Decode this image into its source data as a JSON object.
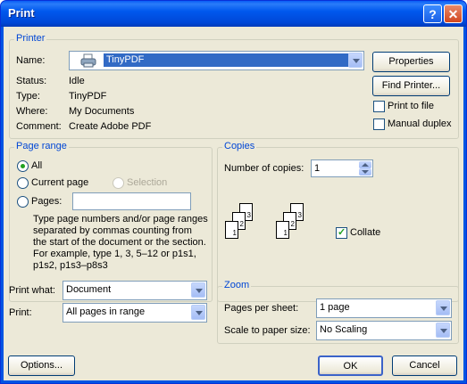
{
  "window": {
    "title": "Print"
  },
  "printer": {
    "group_label": "Printer",
    "name_label": "Name:",
    "name_value": "TinyPDF",
    "status_label": "Status:",
    "status_value": "Idle",
    "type_label": "Type:",
    "type_value": "TinyPDF",
    "where_label": "Where:",
    "where_value": "My Documents",
    "comment_label": "Comment:",
    "comment_value": "Create Adobe PDF",
    "properties_button": "Properties",
    "find_printer_button": "Find Printer...",
    "print_to_file": "Print to file",
    "manual_duplex": "Manual duplex"
  },
  "page_range": {
    "group_label": "Page range",
    "all": "All",
    "current_page": "Current page",
    "selection": "Selection",
    "pages": "Pages:",
    "pages_value": "",
    "help": "Type page numbers and/or page ranges separated by commas counting from the start of the document or the section. For example, type 1, 3, 5–12 or p1s1, p1s2, p1s3–p8s3"
  },
  "copies": {
    "group_label": "Copies",
    "number_label": "Number of copies:",
    "number_value": "1",
    "collate": "Collate",
    "page_labels": [
      "1",
      "2",
      "3"
    ]
  },
  "print_what": {
    "label": "Print what:",
    "value": "Document"
  },
  "print": {
    "label": "Print:",
    "value": "All pages in range"
  },
  "zoom": {
    "group_label": "Zoom",
    "pages_per_sheet_label": "Pages per sheet:",
    "pages_per_sheet_value": "1 page",
    "scale_label": "Scale to paper size:",
    "scale_value": "No Scaling"
  },
  "footer": {
    "options": "Options...",
    "ok": "OK",
    "cancel": "Cancel"
  },
  "colors": {
    "title_bar": "#0054e3",
    "dialog_bg": "#ece9d8",
    "group_label": "#0046d5",
    "selection": "#316ac5"
  }
}
